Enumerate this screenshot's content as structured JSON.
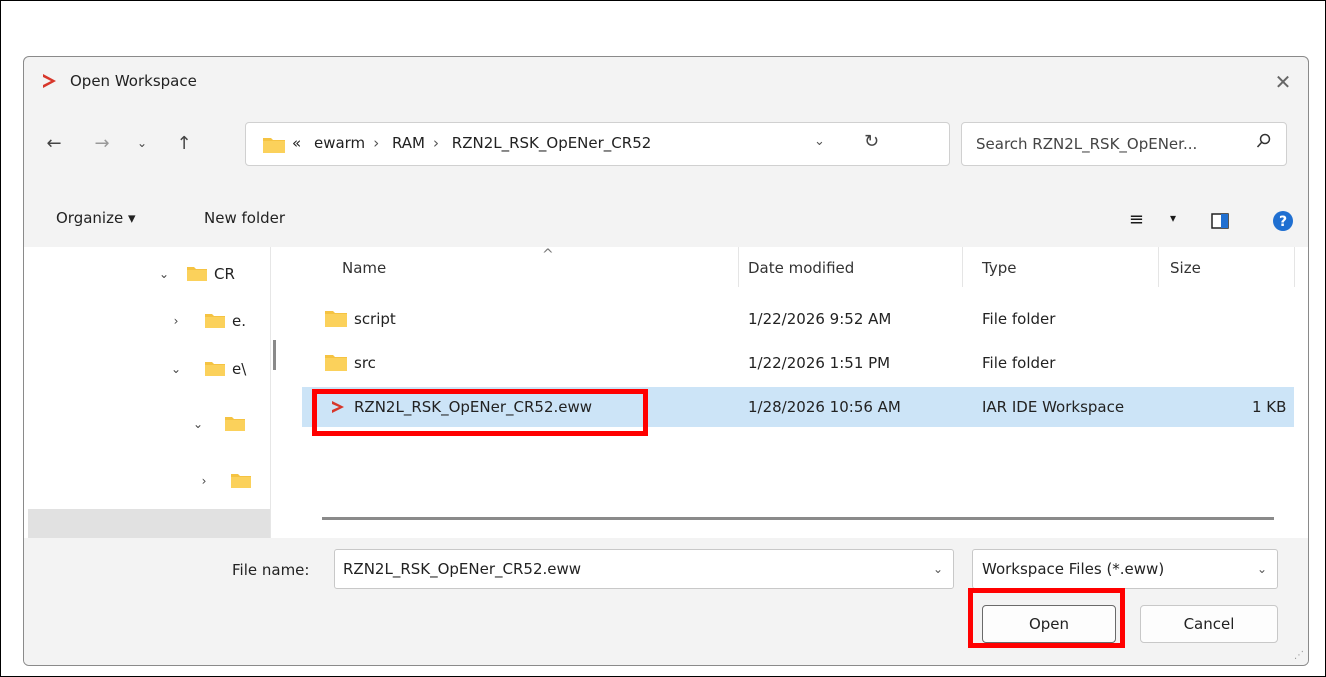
{
  "window": {
    "title": "Open Workspace"
  },
  "nav": {
    "breadcrumbs": [
      "«",
      "ewarm",
      "RAM",
      "RZN2L_RSK_OpENer_CR52"
    ],
    "search_placeholder": "Search RZN2L_RSK_OpENer..."
  },
  "toolbar": {
    "organize": "Organize ▾",
    "new_folder": "New folder"
  },
  "tree": [
    {
      "label": "CR",
      "expanded": true
    },
    {
      "label": "e.",
      "expanded": false
    },
    {
      "label": "e\\",
      "expanded": true
    },
    {
      "label": "",
      "expanded": true
    },
    {
      "label": "",
      "expanded": false
    }
  ],
  "columns": {
    "name": "Name",
    "date": "Date modified",
    "type": "Type",
    "size": "Size"
  },
  "files": [
    {
      "name": "script",
      "date": "1/22/2026 9:52 AM",
      "type": "File folder",
      "size": "",
      "icon": "folder-icon"
    },
    {
      "name": "src",
      "date": "1/22/2026 1:51 PM",
      "type": "File folder",
      "size": "",
      "icon": "folder-icon"
    },
    {
      "name": "RZN2L_RSK_OpENer_CR52.eww",
      "date": "1/28/2026 10:56 AM",
      "type": "IAR IDE Workspace",
      "size": "1 KB",
      "icon": "iar-workspace-icon"
    }
  ],
  "bottom": {
    "file_name_label": "File name:",
    "file_name_value": "RZN2L_RSK_OpENer_CR52.eww",
    "file_type": "Workspace Files (*.eww)",
    "open": "Open",
    "cancel": "Cancel"
  },
  "colors": {
    "highlight": "#ff0000",
    "accent": "#d7372b",
    "folder": "#f5c342",
    "selection": "#cce4f7"
  }
}
